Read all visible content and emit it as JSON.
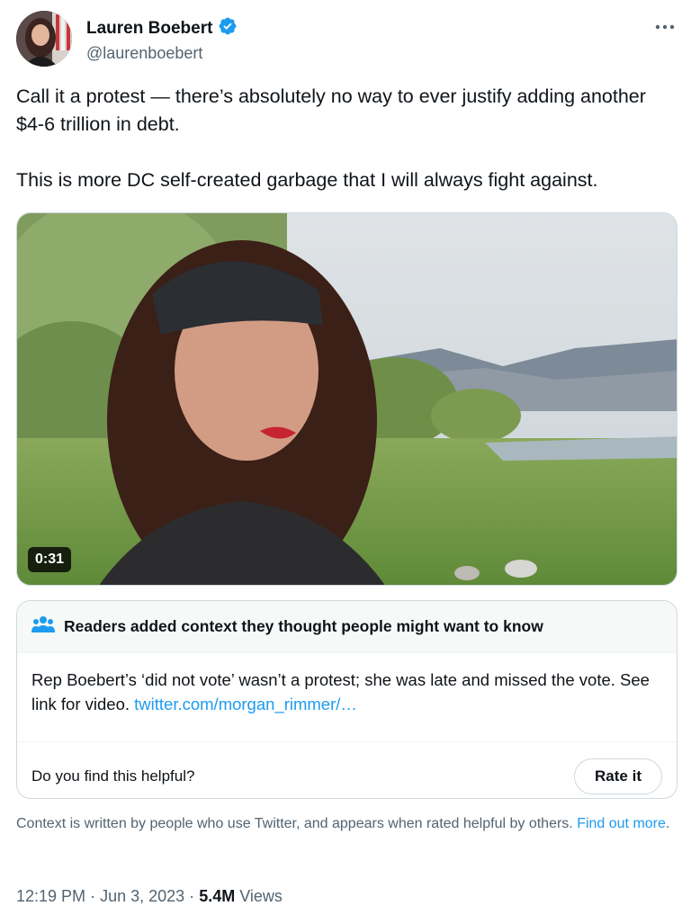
{
  "author": {
    "name": "Lauren Boebert",
    "handle": "@laurenboebert",
    "verified": true,
    "verified_color": "#1d9bf0"
  },
  "tweet": {
    "paragraph1": "Call it a protest — there’s absolutely no way to ever justify adding another $4-6 trillion in debt.",
    "paragraph2": "This is more DC self-created garbage that I will always fight against."
  },
  "media": {
    "duration": "0:31",
    "icon": "video-thumbnail"
  },
  "community_note": {
    "title": "Readers added context they thought people might want to know",
    "body": "Rep Boebert’s ‘did not vote’ wasn’t a protest; she was late and missed the vote. See link for video.",
    "link": "twitter.com/morgan_rimmer/…",
    "question": "Do you find this helpful?",
    "rate_label": "Rate it",
    "icon": "people-icon"
  },
  "disclaimer": {
    "text": "Context is written by people who use Twitter, and appears when rated helpful by others.",
    "link": "Find out more",
    "suffix": "."
  },
  "meta": {
    "time": "12:19 PM",
    "date": "Jun 3, 2023",
    "views_count": "5.4M",
    "views_label": "Views",
    "separator": "·"
  },
  "colors": {
    "accent": "#1d9bf0",
    "text": "#0f1419",
    "secondary": "#536471",
    "border": "#cfd9de"
  }
}
